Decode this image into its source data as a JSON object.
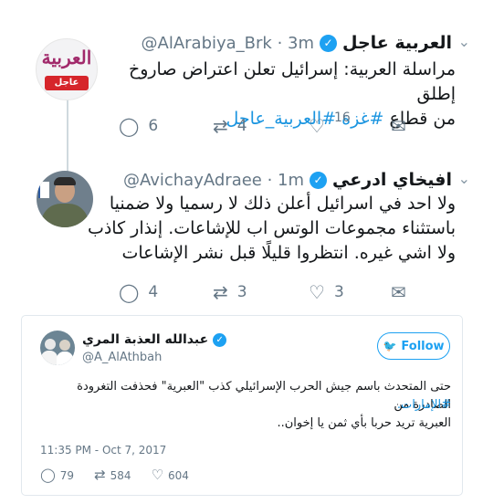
{
  "tweet1": {
    "avatar_logo": "العربية",
    "avatar_badge": "عاجل",
    "name": "العربية عاجل",
    "handle": "@AlArabiya_Brk · 3m",
    "text_line1": "مراسلة العربية: إسرائيل تعلن اعتراض صاروخ إطلق",
    "text_line2": "من قطاع",
    "hashtag": "#غزة #العربية_عاجل",
    "replies": "6",
    "retweets": "4",
    "likes": "16"
  },
  "tweet2": {
    "name": "افيخاي ادرعي",
    "handle": "@AvichayAdraee · 1m",
    "text_line1": "ولا احد في اسرائيل أعلن ذلك لا رسميا ولا ضمنيا",
    "text_line2": "باستثناء مجموعات الوتس اب للإشاعات. إنذار كاذب",
    "text_line3": "ولا اشي غيره. انتظروا قليلًا قبل نشر الإشاعات",
    "replies": "4",
    "retweets": "3",
    "likes": "3"
  },
  "card": {
    "name": "عبدالله العذبة المري",
    "handle": "@A_AlAthbah",
    "follow_label": "Follow",
    "text_line1": "حتى المتحدث باسم جيش الحرب الإسرائيلي كذب \"العبرية\" فحذفت التغرودة الصادرة من",
    "hashtag": "#الإمارات.",
    "text_line3": "العبرية تريد حربا بأي ثمن يا إخوان..",
    "timestamp": "11:35 PM - Oct 7, 2017",
    "replies": "79",
    "retweets": "584",
    "likes": "604"
  },
  "icons": {
    "verified": "verified-badge-icon",
    "reply": "speech-bubble-icon",
    "retweet": "retweet-arrows-icon",
    "like": "heart-icon",
    "dm": "envelope-icon",
    "caret": "chevron-down-icon",
    "twitter": "twitter-bird-icon"
  },
  "colors": {
    "accent": "#1da1f2",
    "hashtag": "#1b95e0",
    "muted": "#657786",
    "brand_arabiya": "#a1296b",
    "breaking_red": "#d6252b"
  }
}
